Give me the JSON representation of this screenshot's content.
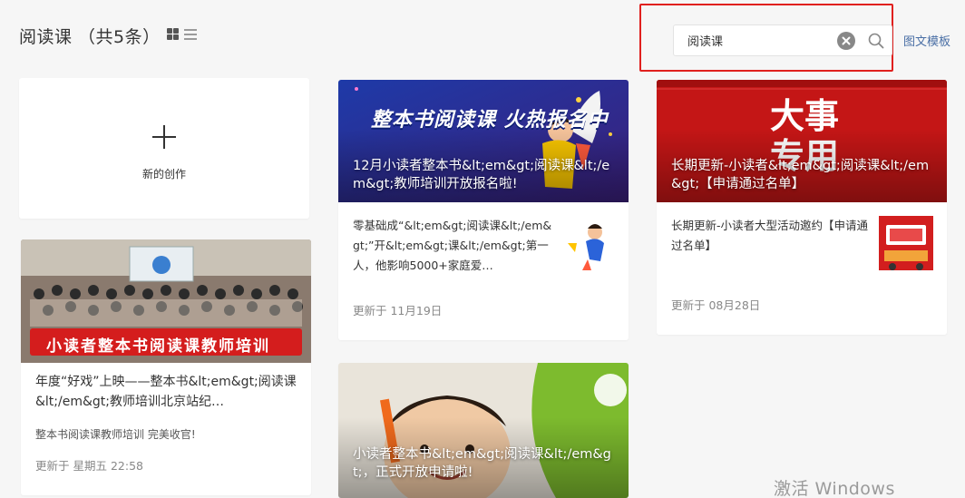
{
  "header": {
    "title": "阅读课 （共5条）"
  },
  "search": {
    "value": "阅读课",
    "template_link": "图文模板"
  },
  "new_card": {
    "label": "新的创作"
  },
  "cards": [
    {
      "cover_text": "整本书阅读课 火热报名中",
      "title": "12月小读者整本书&lt;em&gt;阅读课&lt;/em&gt;教师培训开放报名啦!",
      "summary": "零基础成“&lt;em&gt;阅读课&lt;/em&gt;”开&lt;em&gt;课&lt;/em&gt;第一人，他影响5000+家庭爱…",
      "updated": "更新于 11月19日"
    },
    {
      "cover_text": "大事 专用",
      "title": "长期更新-小读者&lt;em&gt;阅读课&lt;/em&gt;【申请通过名单】",
      "summary": "长期更新-小读者大型活动邀约【申请通过名单】",
      "updated": "更新于 08月28日"
    },
    {
      "cover_text": "小读者整本书阅读课教师培训",
      "title": "年度“好戏”上映——整本书&lt;em&gt;阅读课&lt;/em&gt;教师培训北京站纪…",
      "summary": "整本书阅读课教师培训 完美收官!",
      "updated": "更新于 星期五 22:58"
    },
    {
      "title": "小读者整本书&lt;em&gt;阅读课&lt;/em&gt;，正式开放申请啦!"
    }
  ],
  "watermark": "激活 Windows",
  "colors": {
    "highlight_border": "#e0201e",
    "link": "#4a6fa5",
    "red_cover": "#c41616"
  }
}
